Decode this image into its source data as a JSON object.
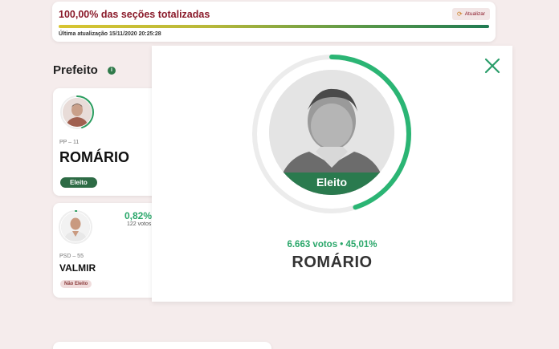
{
  "status": {
    "title": "100,00% das seções totalizadas",
    "refresh_label": "Atualizar",
    "progress": 1.0,
    "last_update": "Última atualização 15/11/2020 20:25:28"
  },
  "section": {
    "title": "Prefeito",
    "info_icon": "i"
  },
  "candidates": [
    {
      "party": "PP – 11",
      "name": "ROMÁRIO",
      "status": "Eleito",
      "ring_fraction": 0.45
    },
    {
      "party": "PSD – 55",
      "name": "VALMIR",
      "status": "Não Eleito",
      "percent": "0,82%",
      "votes": "122 votos",
      "ring_fraction": 0.01
    }
  ],
  "modal": {
    "status": "Eleito",
    "stats": "6.663 votos • 45,01%",
    "name": "ROMÁRIO",
    "ring_fraction": 0.4501
  },
  "colors": {
    "accent_green": "#2aa76a",
    "elected_green": "#2a7a4e",
    "status_red": "#8a1a2a",
    "background": "#f5ecec"
  }
}
